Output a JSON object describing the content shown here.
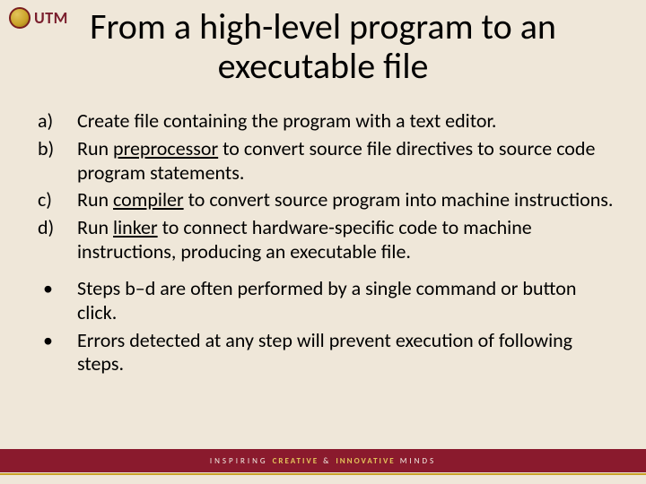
{
  "logo": {
    "text": "UTM"
  },
  "title": "From a high-level program to an executable file",
  "items": [
    {
      "marker": "a)",
      "pre": "Create file containing the program with a text editor.",
      "u": "",
      "post": ""
    },
    {
      "marker": "b)",
      "pre": "Run ",
      "u": "preprocessor",
      "post": " to convert source file directives to source code program statements."
    },
    {
      "marker": "c)",
      "pre": "Run ",
      "u": "compiler",
      "post": " to convert source program into machine instructions."
    },
    {
      "marker": "d)",
      "pre": "Run ",
      "u": "linker",
      "post": " to connect hardware-specific code to machine instructions, producing an executable file."
    }
  ],
  "bullets": [
    {
      "marker": "•",
      "text": "Steps b–d are often performed by a single command or button click."
    },
    {
      "marker": "•",
      "text": "Errors detected at any step will prevent execution of following steps."
    }
  ],
  "footer": {
    "p1": "INSPIRING ",
    "g1": "CREATIVE",
    "p2": " & ",
    "g2": "INNOVATIVE",
    "p3": " MINDS"
  }
}
